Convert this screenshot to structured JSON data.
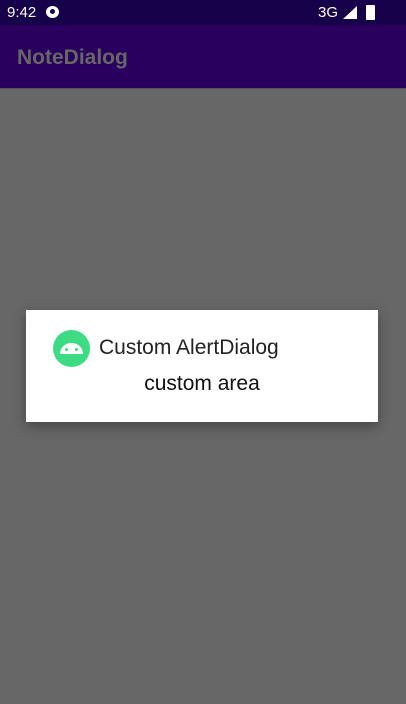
{
  "status_bar": {
    "time": "9:42",
    "network": "3G"
  },
  "app_bar": {
    "title": "NoteDialog"
  },
  "dialog": {
    "title": "Custom AlertDialog",
    "body": "custom area",
    "icon": "android-icon",
    "icon_color": "#3ddc84"
  },
  "colors": {
    "status_bar": "#17004a",
    "app_bar": "#29005e",
    "scrim": "#676767"
  }
}
